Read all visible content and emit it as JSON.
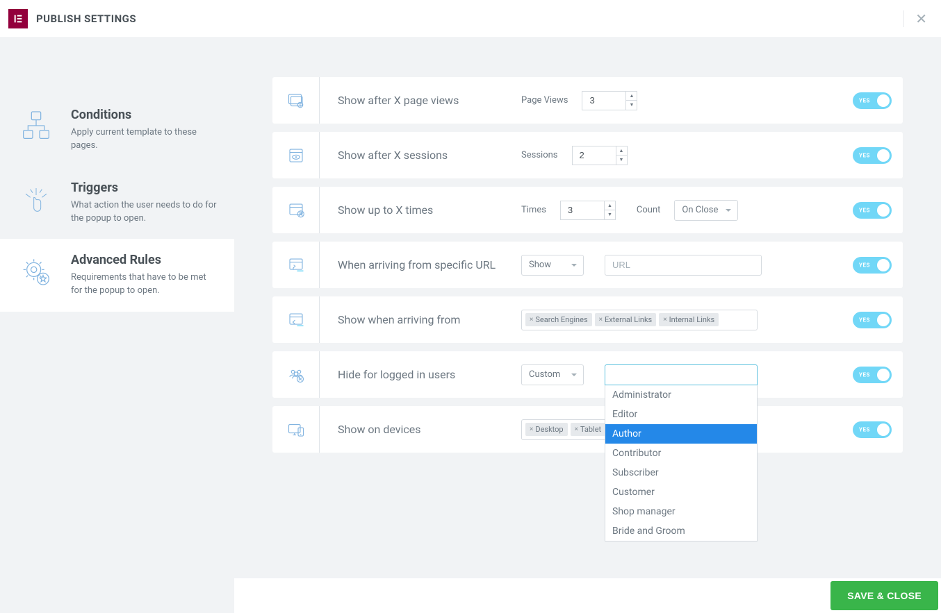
{
  "header": {
    "title": "PUBLISH SETTINGS"
  },
  "sidebar": [
    {
      "title": "Conditions",
      "desc": "Apply current template to these pages."
    },
    {
      "title": "Triggers",
      "desc": "What action the user needs to do for the popup to open."
    },
    {
      "title": "Advanced Rules",
      "desc": "Requirements that have to be met for the popup to open."
    }
  ],
  "rules": {
    "pageViews": {
      "label": "Show after X page views",
      "field": "Page Views",
      "value": "3"
    },
    "sessions": {
      "label": "Show after X sessions",
      "field": "Sessions",
      "value": "2"
    },
    "times": {
      "label": "Show up to X times",
      "field": "Times",
      "value": "3",
      "countLabel": "Count",
      "countValue": "On Close"
    },
    "url": {
      "label": "When arriving from specific URL",
      "select": "Show",
      "placeholder": "URL"
    },
    "arriving": {
      "label": "Show when arriving from",
      "tags": [
        "Search Engines",
        "External Links",
        "Internal Links"
      ]
    },
    "loggedIn": {
      "label": "Hide for logged in users",
      "select": "Custom",
      "roles": [
        "Administrator",
        "Editor",
        "Author",
        "Contributor",
        "Subscriber",
        "Customer",
        "Shop manager",
        "Bride and Groom"
      ],
      "highlighted": 2
    },
    "devices": {
      "label": "Show on devices",
      "tags": [
        "Desktop",
        "Tablet"
      ]
    }
  },
  "toggle": {
    "yes": "YES"
  },
  "footer": {
    "saveClose": "SAVE & CLOSE"
  }
}
